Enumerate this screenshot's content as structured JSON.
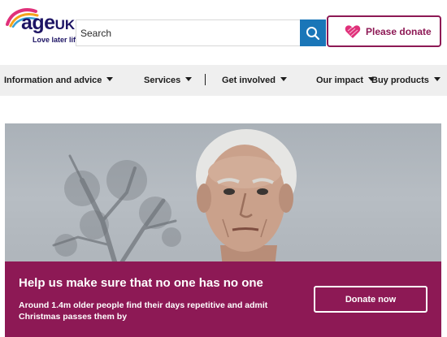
{
  "logo": {
    "word": "age",
    "word_suffix": "UK",
    "tagline": "Love later life"
  },
  "search": {
    "placeholder": "Search",
    "button_icon": "search-icon"
  },
  "donate": {
    "label": "Please donate",
    "icon": "heart-icon"
  },
  "nav": {
    "items": [
      {
        "label": "Information and advice"
      },
      {
        "label": "Services"
      },
      {
        "label": "Get involved"
      },
      {
        "label": "Our impact"
      },
      {
        "label": "Buy products"
      }
    ]
  },
  "promo": {
    "title": "Help us make sure that no one has no one",
    "text": "Around 1.4m older people find their days repetitive and admit Christmas passes them by",
    "button_label": "Donate now"
  },
  "colors": {
    "brand_purple": "#8d1955",
    "search_blue": "#1a76b8",
    "logo_navy": "#1d1464",
    "nav_bg": "#efefef"
  }
}
